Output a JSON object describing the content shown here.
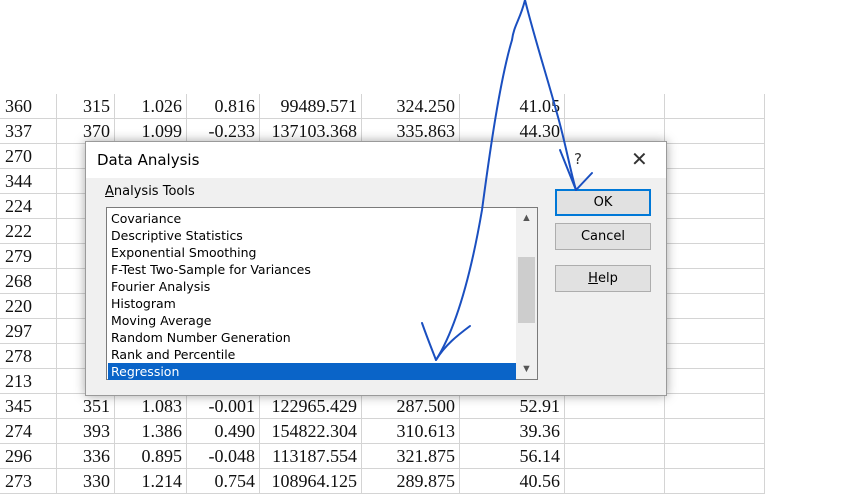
{
  "spreadsheet": {
    "rows": [
      [
        "360",
        "315",
        "1.026",
        "0.816",
        "99489.571",
        "324.250",
        "41.05"
      ],
      [
        "337",
        "370",
        "1.099",
        "-0.233",
        "137103.368",
        "335.863",
        "44.30"
      ],
      [
        "270",
        "3",
        "",
        "",
        "",
        "",
        ""
      ],
      [
        "344",
        "3",
        "",
        "",
        "",
        "",
        ""
      ],
      [
        "224",
        "3",
        "",
        "",
        "",
        "",
        ""
      ],
      [
        "222",
        "3",
        "",
        "",
        "",
        "",
        ""
      ],
      [
        "279",
        "3",
        "",
        "",
        "",
        "",
        ""
      ],
      [
        "268",
        "3",
        "",
        "",
        "",
        "",
        ""
      ],
      [
        "220",
        "3",
        "",
        "",
        "",
        "",
        ""
      ],
      [
        "297",
        "3",
        "",
        "",
        "",
        "",
        ""
      ],
      [
        "278",
        "3",
        "",
        "",
        "",
        "",
        ""
      ],
      [
        "213",
        "3",
        "",
        "",
        "",
        "",
        ""
      ],
      [
        "345",
        "351",
        "1.083",
        "-0.001",
        "122965.429",
        "287.500",
        "52.91"
      ],
      [
        "274",
        "393",
        "1.386",
        "0.490",
        "154822.304",
        "310.613",
        "39.36"
      ],
      [
        "296",
        "336",
        "0.895",
        "-0.048",
        "113187.554",
        "321.875",
        "56.14"
      ],
      [
        "273",
        "330",
        "1.214",
        "0.754",
        "108964.125",
        "289.875",
        "40.56"
      ]
    ]
  },
  "dialog": {
    "title": "Data Analysis",
    "help_glyph": "?",
    "close_glyph": "✕",
    "group_label_mnemonic": "A",
    "group_label_rest": "nalysis Tools",
    "tools": [
      "Covariance",
      "Descriptive Statistics",
      "Exponential Smoothing",
      "F-Test Two-Sample for Variances",
      "Fourier Analysis",
      "Histogram",
      "Moving Average",
      "Random Number Generation",
      "Rank and Percentile",
      "Regression"
    ],
    "selected_tool": "Regression",
    "ok_label": "OK",
    "cancel_label": "Cancel",
    "help_mnemonic": "H",
    "help_rest": "elp",
    "scroll_up_glyph": "▲",
    "scroll_down_glyph": "▼"
  },
  "annotation": {
    "ink_color": "#1a4fc0"
  }
}
